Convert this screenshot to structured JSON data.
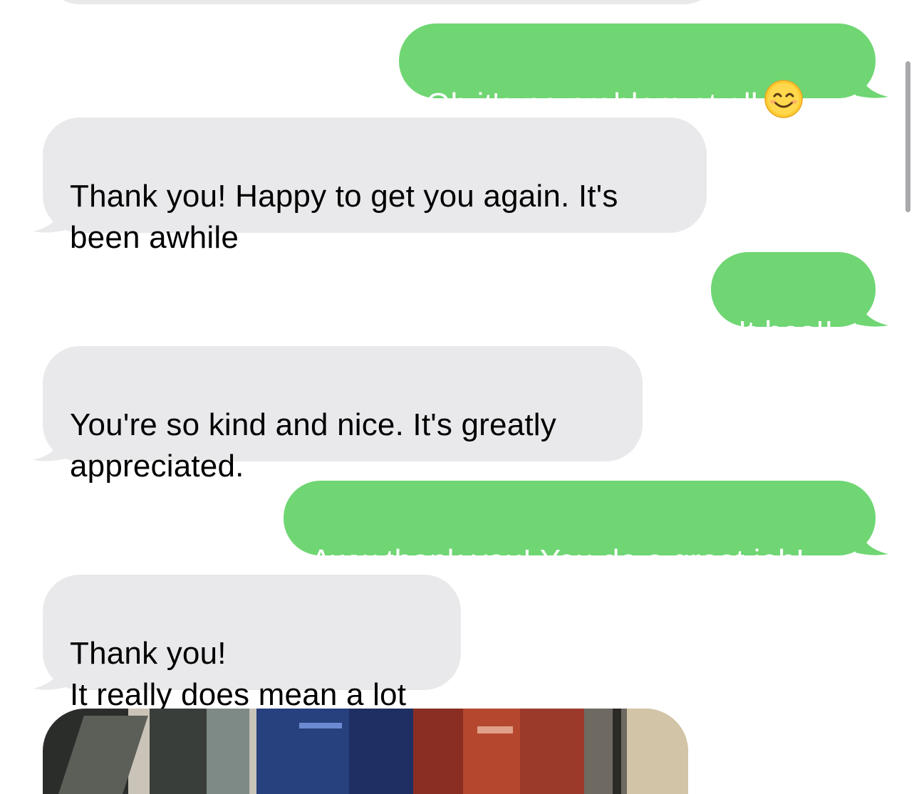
{
  "colors": {
    "outgoing_bubble": "#6fd673",
    "incoming_bubble": "#e9e9eb",
    "outgoing_text": "#ffffff",
    "incoming_text": "#000000",
    "background": "#ffffff"
  },
  "messages": [
    {
      "direction": "outgoing",
      "text": "Oh it's no problem at all",
      "emoji": "smiling-face-icon"
    },
    {
      "direction": "incoming",
      "text": "Thank you! Happy to get you again. It's\nbeen awhile"
    },
    {
      "direction": "outgoing",
      "text": "It has!!"
    },
    {
      "direction": "incoming",
      "text": "You're so kind and nice. It's greatly\nappreciated."
    },
    {
      "direction": "outgoing",
      "text": "Aww thank you! You do a great job!"
    },
    {
      "direction": "incoming",
      "text": "Thank you!\nIt really does mean a lot"
    },
    {
      "direction": "incoming",
      "type": "photo-attachment"
    }
  ]
}
